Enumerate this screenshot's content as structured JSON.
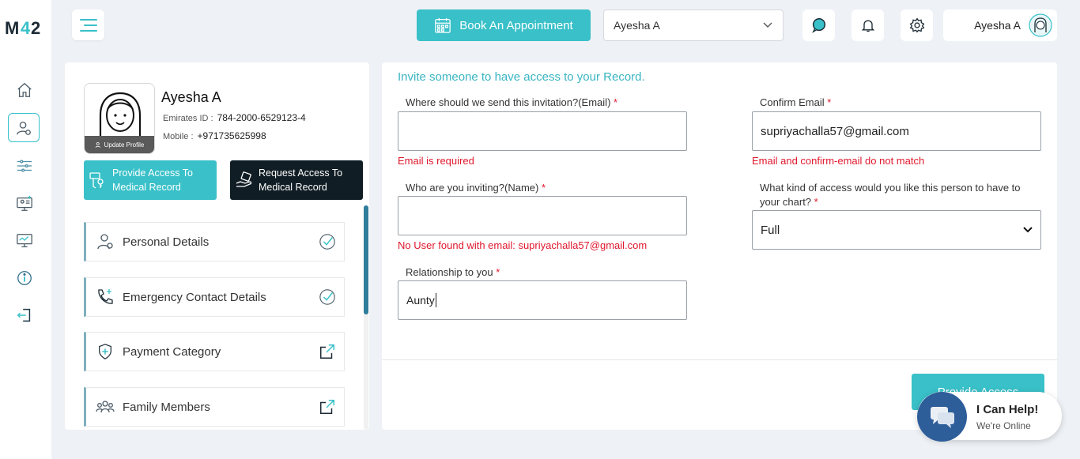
{
  "app": {
    "logo_text": "M42"
  },
  "topbar": {
    "book_label": "Book An Appointment",
    "user_select_value": "Ayesha A",
    "profile_name": "Ayesha A"
  },
  "profile": {
    "name": "Ayesha A",
    "update_label": "Update Profile",
    "emirates_label": "Emirates ID :",
    "emirates_value": "784-2000-6529123-4",
    "mobile_label": "Mobile :",
    "mobile_value": "+971735625998",
    "provide_access_line1": "Provide Access To",
    "provide_access_line2": "Medical Record",
    "request_access_line1": "Request Access To",
    "request_access_line2": "Medical Record"
  },
  "menu": {
    "items": [
      {
        "label": "Personal Details",
        "icon": "person-icon",
        "end": "check-circle-icon"
      },
      {
        "label": "Emergency Contact Details",
        "icon": "phone-plus-icon",
        "end": "check-circle-icon"
      },
      {
        "label": "Payment Category",
        "icon": "shield-plus-icon",
        "end": "external-link-icon"
      },
      {
        "label": "Family Members",
        "icon": "family-icon",
        "end": "external-link-icon"
      }
    ]
  },
  "form": {
    "title": "Invite someone to have access to your Record.",
    "email_label": "Where should we send this invitation?(Email)",
    "email_value": "",
    "email_error": "Email is required",
    "confirm_label": "Confirm Email",
    "confirm_value": "supriyachalla57@gmail.com",
    "confirm_error": "Email and confirm-email do not match",
    "name_label": "Who are you inviting?(Name)",
    "name_value": "",
    "name_error": "No User found with email: supriyachalla57@gmail.com",
    "access_label_line1": "What kind of access would you like this person to have to",
    "access_label_line2": "your chart?",
    "access_value": "Full",
    "relationship_label": "Relationship to you",
    "relationship_value": "Aunty",
    "required_mark": "*",
    "submit_label": "Provide Access"
  },
  "chat": {
    "title": "I Can Help!",
    "subtitle": "We're Online"
  },
  "colors": {
    "accent": "#39c0c8",
    "dark": "#101d24",
    "error": "#e0182d",
    "chat": "#2e5e9a"
  }
}
